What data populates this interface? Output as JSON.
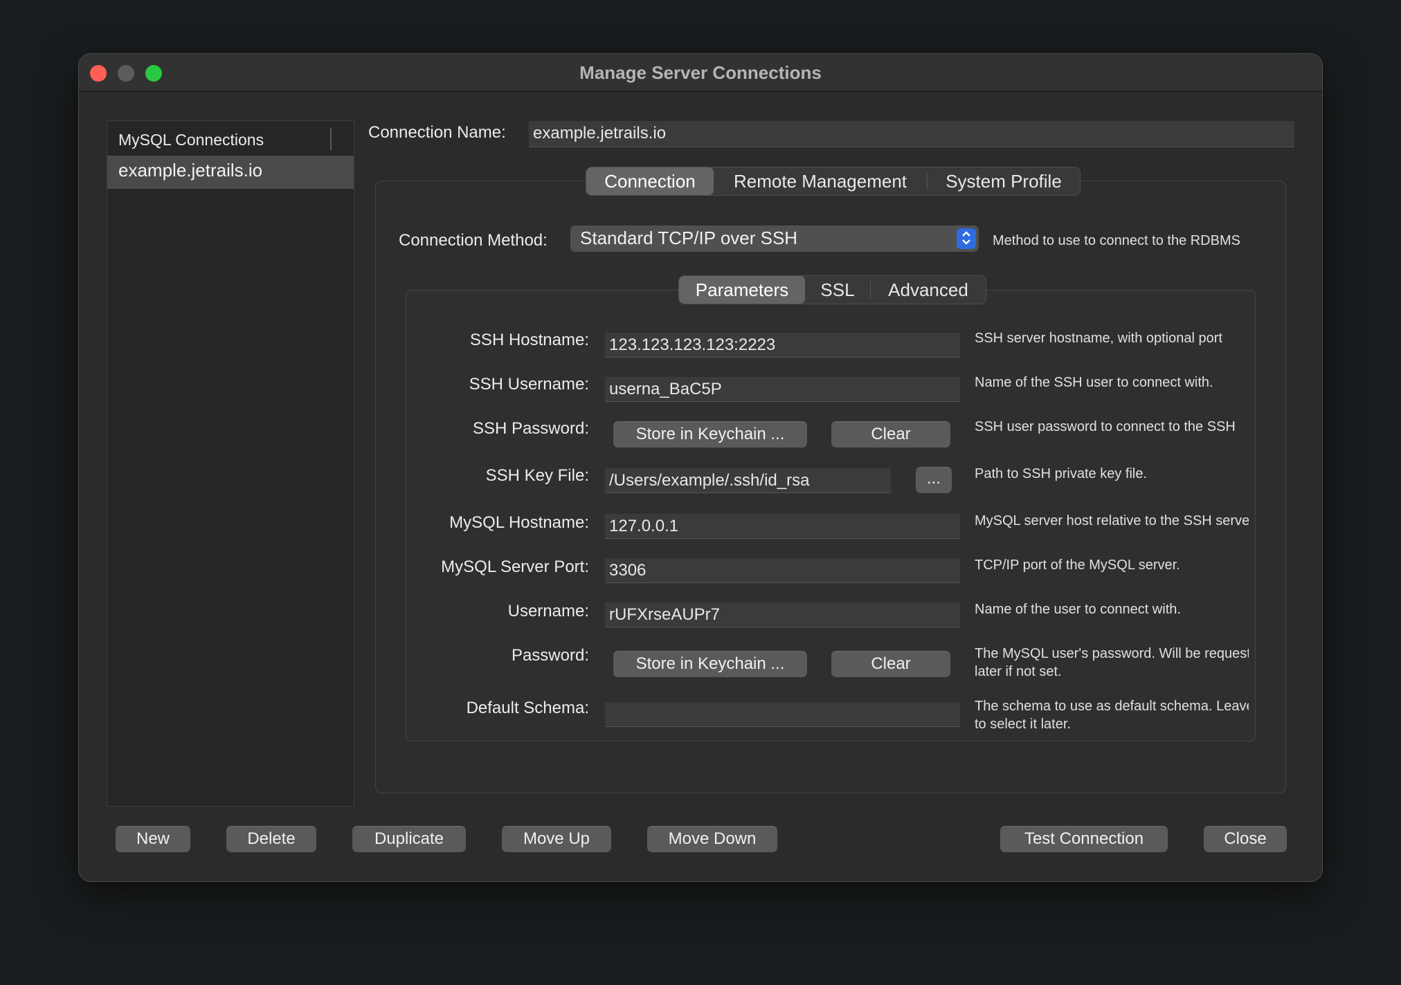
{
  "window": {
    "title": "Manage Server Connections"
  },
  "sidebar": {
    "header": "MySQL Connections",
    "items": [
      {
        "label": "example.jetrails.io",
        "selected": true
      }
    ]
  },
  "connection_name": {
    "label": "Connection Name:",
    "value": "example.jetrails.io"
  },
  "main_tabs": [
    {
      "label": "Connection",
      "active": true
    },
    {
      "label": "Remote Management",
      "active": false
    },
    {
      "label": "System Profile",
      "active": false
    }
  ],
  "connection_method": {
    "label": "Connection Method:",
    "value": "Standard TCP/IP over SSH",
    "help": "Method to use to connect to the RDBMS"
  },
  "sub_tabs": [
    {
      "label": "Parameters",
      "active": true
    },
    {
      "label": "SSL",
      "active": false
    },
    {
      "label": "Advanced",
      "active": false
    }
  ],
  "params": {
    "ssh_hostname": {
      "label": "SSH Hostname:",
      "value": "123.123.123.123:2223",
      "help": "SSH server hostname, with  optional port"
    },
    "ssh_username": {
      "label": "SSH Username:",
      "value": "userna_BaC5P",
      "help": "Name of the SSH user to connect with."
    },
    "ssh_password": {
      "label": "SSH Password:",
      "store_label": "Store in Keychain ...",
      "clear_label": "Clear",
      "help": "SSH user password to connect to the SSH"
    },
    "ssh_key_file": {
      "label": "SSH Key File:",
      "value": "/Users/example/.ssh/id_rsa",
      "browse_label": "...",
      "help": "Path to SSH private key file."
    },
    "mysql_hostname": {
      "label": "MySQL Hostname:",
      "value": "127.0.0.1",
      "help": "MySQL server host relative to the SSH server"
    },
    "mysql_port": {
      "label": "MySQL Server Port:",
      "value": "3306",
      "help": "TCP/IP port of the MySQL server."
    },
    "username": {
      "label": "Username:",
      "value": "rUFXrseAUPr7",
      "help": "Name of the user to connect with."
    },
    "password": {
      "label": "Password:",
      "store_label": "Store in Keychain ...",
      "clear_label": "Clear",
      "help_line1": "The MySQL user's password. Will be requested",
      "help_line2": "later if not set."
    },
    "default_schema": {
      "label": "Default Schema:",
      "value": "",
      "help_line1": "The schema to use as default schema. Leave",
      "help_line2": "to select it later."
    }
  },
  "footer": {
    "new": "New",
    "delete": "Delete",
    "duplicate": "Duplicate",
    "move_up": "Move Up",
    "move_down": "Move Down",
    "test_connection": "Test Connection",
    "close": "Close"
  },
  "colors": {
    "accent": "#2d6be0",
    "close": "#ff5f57",
    "maximize": "#28c840"
  },
  "icons": [
    "chevron-updown-icon"
  ]
}
